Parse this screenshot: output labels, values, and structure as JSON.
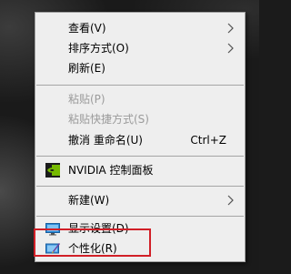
{
  "context_menu": {
    "items": [
      {
        "label": "查看(V)",
        "disabled": false,
        "submenu": true
      },
      {
        "label": "排序方式(O)",
        "disabled": false,
        "submenu": true
      },
      {
        "label": "刷新(E)",
        "disabled": false
      },
      {
        "label": "粘贴(P)",
        "disabled": true
      },
      {
        "label": "粘贴快捷方式(S)",
        "disabled": true
      },
      {
        "label": "撤消 重命名(U)",
        "disabled": false,
        "shortcut": "Ctrl+Z"
      },
      {
        "label": "NVIDIA 控制面板",
        "disabled": false,
        "icon": "nvidia-logo-icon"
      },
      {
        "label": "新建(W)",
        "disabled": false,
        "submenu": true
      },
      {
        "label": "显示设置(D)",
        "disabled": false,
        "icon": "display-settings-icon"
      },
      {
        "label": "个性化(R)",
        "disabled": false,
        "icon": "personalize-icon",
        "annotated": true
      }
    ]
  },
  "annotation": {
    "color": "#d11f27"
  }
}
